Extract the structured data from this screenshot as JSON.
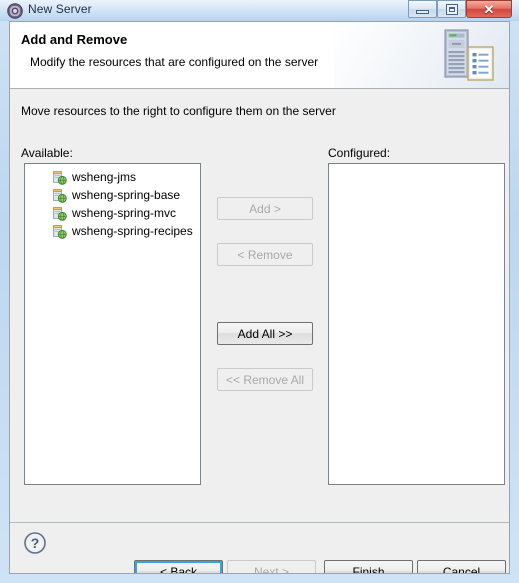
{
  "window": {
    "title": "New Server",
    "title_icon": "server-gear-icon",
    "controls": {
      "minimize_label": "minimize-icon",
      "maximize_label": "restore-icon",
      "close_label": "✕"
    }
  },
  "header": {
    "title": "Add and Remove",
    "description": "Modify the resources that are configured on the server",
    "icon": "server-and-document-icon"
  },
  "body": {
    "instruction": "Move resources to the right to configure them on the server",
    "available": {
      "label": "Available:",
      "items": [
        {
          "label": "wsheng-jms",
          "icon": "web-module-icon"
        },
        {
          "label": "wsheng-spring-base",
          "icon": "web-module-icon"
        },
        {
          "label": "wsheng-spring-mvc",
          "icon": "web-module-icon"
        },
        {
          "label": "wsheng-spring-recipes",
          "icon": "web-module-icon"
        }
      ]
    },
    "configured": {
      "label": "Configured:",
      "items": []
    },
    "transfer_buttons": [
      {
        "label": "Add >",
        "enabled": false
      },
      {
        "label": "< Remove",
        "enabled": false
      },
      {
        "label": "Add All >>",
        "enabled": true
      },
      {
        "label": "<< Remove All",
        "enabled": false
      }
    ]
  },
  "footer": {
    "help_icon": "help-question-icon",
    "buttons": [
      {
        "label": "< Back",
        "enabled": true,
        "default": true
      },
      {
        "label": "Next >",
        "enabled": false,
        "default": false
      },
      {
        "label": "Finish",
        "enabled": true,
        "default": false
      },
      {
        "label": "Cancel",
        "enabled": true,
        "default": false
      }
    ]
  },
  "colors": {
    "titlebar": "#cfe2f5",
    "dialog_background": "#efefef",
    "header_background": "#ffffff",
    "listbox_background": "#ffffff",
    "listbox_border": "#7a8491",
    "close_button": "#d4453a",
    "focus_ring": "#3aa3dd",
    "disabled_text": "#a8a8a8"
  }
}
